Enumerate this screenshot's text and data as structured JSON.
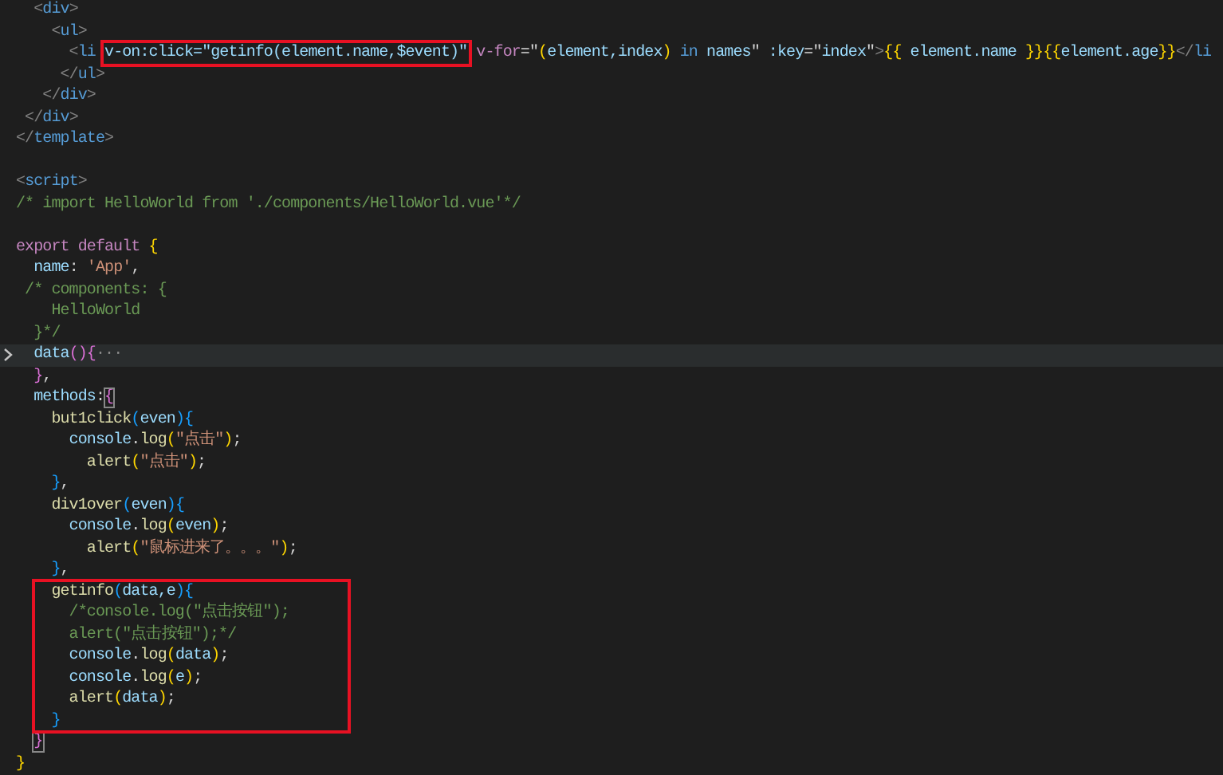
{
  "editor": {
    "lines": [
      {
        "tokens": [
          {
            "text": "  <",
            "kind": "tag"
          },
          {
            "text": "div",
            "kind": "tagname"
          },
          {
            "text": ">",
            "kind": "tag"
          }
        ]
      },
      {
        "tokens": [
          {
            "text": "    <",
            "kind": "tag"
          },
          {
            "text": "ul",
            "kind": "tagname"
          },
          {
            "text": ">",
            "kind": "tag"
          }
        ]
      },
      {
        "tokens": [
          {
            "text": "      <",
            "kind": "tag"
          },
          {
            "text": "li ",
            "kind": "tagname"
          },
          {
            "text": "v-on:click=\"getinfo(element.name,$event)\"",
            "kind": "attr",
            "boxed": true
          },
          {
            "text": " v-for",
            "kind": "keyword"
          },
          {
            "text": "=\"",
            "kind": "plain"
          },
          {
            "text": "(",
            "kind": "b1"
          },
          {
            "text": "element,index",
            "kind": "var"
          },
          {
            "text": ")",
            "kind": "b1"
          },
          {
            "text": " in ",
            "kind": "tagname"
          },
          {
            "text": "names",
            "kind": "var"
          },
          {
            "text": "\" ",
            "kind": "plain"
          },
          {
            "text": ":key",
            "kind": "attr"
          },
          {
            "text": "=\"",
            "kind": "plain"
          },
          {
            "text": "index",
            "kind": "var"
          },
          {
            "text": "\"",
            "kind": "plain"
          },
          {
            "text": ">",
            "kind": "tag"
          },
          {
            "text": "{{",
            "kind": "b1"
          },
          {
            "text": " element.name ",
            "kind": "var"
          },
          {
            "text": "}}{{",
            "kind": "b1"
          },
          {
            "text": "element.age",
            "kind": "var"
          },
          {
            "text": "}}",
            "kind": "b1"
          },
          {
            "text": "</",
            "kind": "tag"
          },
          {
            "text": "li",
            "kind": "tagname"
          }
        ]
      },
      {
        "tokens": [
          {
            "text": "     </",
            "kind": "tag"
          },
          {
            "text": "ul",
            "kind": "tagname"
          },
          {
            "text": ">",
            "kind": "tag"
          }
        ]
      },
      {
        "tokens": [
          {
            "text": "   </",
            "kind": "tag"
          },
          {
            "text": "div",
            "kind": "tagname"
          },
          {
            "text": ">",
            "kind": "tag"
          }
        ]
      },
      {
        "tokens": [
          {
            "text": " </",
            "kind": "tag"
          },
          {
            "text": "div",
            "kind": "tagname"
          },
          {
            "text": ">",
            "kind": "tag"
          }
        ]
      },
      {
        "blank_after": true,
        "tokens": [
          {
            "text": "</",
            "kind": "tag"
          },
          {
            "text": "template",
            "kind": "tagname"
          },
          {
            "text": ">",
            "kind": "tag"
          }
        ]
      },
      {
        "tokens": [
          {
            "text": "<",
            "kind": "tag"
          },
          {
            "text": "script",
            "kind": "tagname"
          },
          {
            "text": ">",
            "kind": "tag"
          }
        ]
      },
      {
        "blank_after": true,
        "tokens": [
          {
            "text": "/* import HelloWorld from './components/HelloWorld.vue'*/",
            "kind": "comment"
          }
        ]
      },
      {
        "tokens": [
          {
            "text": "export default ",
            "kind": "keyword"
          },
          {
            "text": "{",
            "kind": "b1"
          }
        ]
      },
      {
        "tokens": [
          {
            "text": "  name",
            "kind": "var"
          },
          {
            "text": ": ",
            "kind": "plain"
          },
          {
            "text": "'App'",
            "kind": "string"
          },
          {
            "text": ",",
            "kind": "plain"
          }
        ]
      },
      {
        "tokens": [
          {
            "text": " /* components: {",
            "kind": "comment"
          }
        ]
      },
      {
        "tokens": [
          {
            "text": "    HelloWorld",
            "kind": "comment"
          }
        ]
      },
      {
        "tokens": [
          {
            "text": "  }*/",
            "kind": "comment"
          }
        ]
      },
      {
        "folded": true,
        "tokens": [
          {
            "text": "  data",
            "kind": "var"
          },
          {
            "text": "(){",
            "kind": "b2"
          },
          {
            "text": "···",
            "kind": "fold"
          }
        ]
      },
      {
        "tokens": [
          {
            "text": "  }",
            "kind": "b2"
          },
          {
            "text": ",",
            "kind": "plain"
          }
        ]
      },
      {
        "tokens": [
          {
            "text": "  methods",
            "kind": "var"
          },
          {
            "text": ":",
            "kind": "plain"
          },
          {
            "text": "{",
            "kind": "b2",
            "matched": true
          }
        ]
      },
      {
        "tokens": [
          {
            "text": "    but1click",
            "kind": "func"
          },
          {
            "text": "(",
            "kind": "b3"
          },
          {
            "text": "even",
            "kind": "var"
          },
          {
            "text": "){",
            "kind": "b3"
          }
        ]
      },
      {
        "tokens": [
          {
            "text": "      console",
            "kind": "var"
          },
          {
            "text": ".",
            "kind": "plain"
          },
          {
            "text": "log",
            "kind": "func"
          },
          {
            "text": "(",
            "kind": "b1"
          },
          {
            "text": "\"点击\"",
            "kind": "string"
          },
          {
            "text": ")",
            "kind": "b1"
          },
          {
            "text": ";",
            "kind": "plain"
          }
        ]
      },
      {
        "tokens": [
          {
            "text": "        alert",
            "kind": "func"
          },
          {
            "text": "(",
            "kind": "b1"
          },
          {
            "text": "\"点击\"",
            "kind": "string"
          },
          {
            "text": ")",
            "kind": "b1"
          },
          {
            "text": ";",
            "kind": "plain"
          }
        ]
      },
      {
        "tokens": [
          {
            "text": "    }",
            "kind": "b3"
          },
          {
            "text": ",",
            "kind": "plain"
          }
        ]
      },
      {
        "tokens": [
          {
            "text": "    div1over",
            "kind": "func"
          },
          {
            "text": "(",
            "kind": "b3"
          },
          {
            "text": "even",
            "kind": "var"
          },
          {
            "text": "){",
            "kind": "b3"
          }
        ]
      },
      {
        "tokens": [
          {
            "text": "      console",
            "kind": "var"
          },
          {
            "text": ".",
            "kind": "plain"
          },
          {
            "text": "log",
            "kind": "func"
          },
          {
            "text": "(",
            "kind": "b1"
          },
          {
            "text": "even",
            "kind": "var"
          },
          {
            "text": ")",
            "kind": "b1"
          },
          {
            "text": ";",
            "kind": "plain"
          }
        ]
      },
      {
        "tokens": [
          {
            "text": "        alert",
            "kind": "func"
          },
          {
            "text": "(",
            "kind": "b1"
          },
          {
            "text": "\"鼠标进来了。。。\"",
            "kind": "string"
          },
          {
            "text": ")",
            "kind": "b1"
          },
          {
            "text": ";",
            "kind": "plain"
          }
        ]
      },
      {
        "tokens": [
          {
            "text": "    }",
            "kind": "b3"
          },
          {
            "text": ",",
            "kind": "plain"
          }
        ]
      },
      {
        "boxed": true,
        "tokens": [
          {
            "text": "    getinfo",
            "kind": "func"
          },
          {
            "text": "(",
            "kind": "b3"
          },
          {
            "text": "data,e",
            "kind": "var"
          },
          {
            "text": "){",
            "kind": "b3"
          }
        ]
      },
      {
        "boxed": true,
        "tokens": [
          {
            "text": "      /*console.log(\"点击按钮\");",
            "kind": "comment"
          }
        ]
      },
      {
        "boxed": true,
        "tokens": [
          {
            "text": "      alert(\"点击按钮\");*/",
            "kind": "comment"
          }
        ]
      },
      {
        "boxed": true,
        "tokens": [
          {
            "text": "      console",
            "kind": "var"
          },
          {
            "text": ".",
            "kind": "plain"
          },
          {
            "text": "log",
            "kind": "func"
          },
          {
            "text": "(",
            "kind": "b1"
          },
          {
            "text": "data",
            "kind": "var"
          },
          {
            "text": ")",
            "kind": "b1"
          },
          {
            "text": ";",
            "kind": "plain"
          }
        ]
      },
      {
        "boxed": true,
        "tokens": [
          {
            "text": "      console",
            "kind": "var"
          },
          {
            "text": ".",
            "kind": "plain"
          },
          {
            "text": "log",
            "kind": "func"
          },
          {
            "text": "(",
            "kind": "b1"
          },
          {
            "text": "e",
            "kind": "var"
          },
          {
            "text": ")",
            "kind": "b1"
          },
          {
            "text": ";",
            "kind": "plain"
          }
        ]
      },
      {
        "boxed": true,
        "tokens": [
          {
            "text": "      alert",
            "kind": "func"
          },
          {
            "text": "(",
            "kind": "b1"
          },
          {
            "text": "data",
            "kind": "var"
          },
          {
            "text": ")",
            "kind": "b1"
          },
          {
            "text": ";",
            "kind": "plain"
          }
        ]
      },
      {
        "boxed": true,
        "tokens": [
          {
            "text": "    }",
            "kind": "b3"
          }
        ]
      },
      {
        "tokens": [
          {
            "text": "  }",
            "kind": "b2",
            "matched": true
          }
        ]
      },
      {
        "tokens": [
          {
            "text": "}",
            "kind": "b1"
          }
        ]
      }
    ]
  }
}
